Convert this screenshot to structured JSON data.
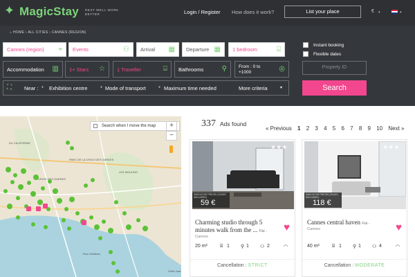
{
  "header": {
    "logo": "MagicStay",
    "tagline": "REST WELL WORK BETTER",
    "login_register": "Login / Register",
    "how_it_works": "How does it work?",
    "list_your_place": "List your place",
    "currency": "€",
    "language_flag": "flag-icon"
  },
  "search": {
    "breadcrumb": [
      "HOME",
      "ALL CITIES",
      "CANNES (REGION)"
    ],
    "location": "Cannes (region)",
    "events": "Events",
    "arrival": "Arrival",
    "departure": "Departure",
    "bedrooms": "1 bedroom",
    "accommodation": "Accommodation",
    "stars": "1+ Stars",
    "travellers": "1 Traveller",
    "bathrooms": "Bathrooms",
    "price_range": "From : 0 to +1000",
    "instant_booking": "Instant booking",
    "flexible_dates": "Flexible dates",
    "property_id_placeholder": "Property ID",
    "near_label": "Near :",
    "near_option": "Exhibition centre",
    "transport": "Mode of transport",
    "max_time": "Maximum time needed",
    "more_criteria": "More criteria",
    "search_button": "Search"
  },
  "map": {
    "toggle_label": "Search when I move the map",
    "zoom_in": "+",
    "zoom_out": "−",
    "labels": [
      "DU CALIFORNIE",
      "CROIX DES GARDES",
      "LES MOULINS",
      "PARC DE LA CROIX DES GARDES",
      "Rue d'Antibes",
      "Golfe-Juan"
    ]
  },
  "results": {
    "count": "337",
    "count_label": "Ads found",
    "pagination": [
      "« Previous",
      "1",
      "2",
      "3",
      "4",
      "5",
      "6",
      "7",
      "8",
      "9",
      "10",
      "Next »"
    ],
    "current_page": "1",
    "price_note": "INDICATIVE PRICES (TAXES INCLUDED)",
    "cancellation_label": "Cancellation :",
    "listings": [
      {
        "stars": "★★★",
        "price": "59 €",
        "title": "Charming studio through 5 minutes walk from the ...",
        "type": "Flat -",
        "city": "Cannes",
        "area": "20 m²",
        "beds": "1",
        "baths": "1",
        "guests": "2",
        "cancellation": "STRICT"
      },
      {
        "stars": "★★★",
        "price": "118 €",
        "title": "Cannes central haven",
        "type": "Flat -",
        "city": "Cannes",
        "area": "40 m²",
        "beds": "1",
        "baths": "1",
        "guests": "4",
        "cancellation": "MODERATE"
      }
    ]
  },
  "colors": {
    "accent_pink": "#f2478e",
    "accent_green": "#7dd37b",
    "header_bg": "#2e3033",
    "panel_bg": "#34373b"
  }
}
